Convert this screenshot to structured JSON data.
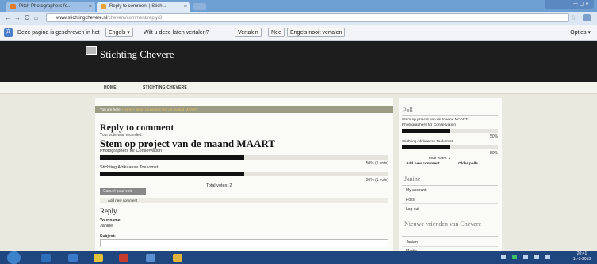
{
  "browser": {
    "tabs": [
      {
        "label": "Pitch Photographers fo..."
      },
      {
        "label": "Reply to comment | Stich..."
      }
    ],
    "address": {
      "host": "www.stichtingchevere.nl",
      "path": "/chevere/comment/reply/3"
    }
  },
  "translate_bar": {
    "message": "Deze pagina is geschreven in het",
    "language_button": "Engels ▾",
    "question": "Wilt u deze laten vertalen?",
    "translate": "Vertalen",
    "no": "Nee",
    "never": "Engels nooit vertalen",
    "options": "Opties ▾"
  },
  "site": {
    "name": "Stichting Chevere",
    "menu": [
      "HOME",
      "STICHTING CHEVERE"
    ]
  },
  "main": {
    "breadcrumb_label": "You are here:",
    "breadcrumb_links": "Home » Stem op project van de maand MAART",
    "page_title": "Reply to comment",
    "vote_recorded": "Your vote was recorded.",
    "poll_title": "Stem op project van de maand MAART",
    "poll_options": [
      {
        "label": "Photographers for Conservation",
        "percent_text": "50% (1 vote)",
        "fraction": 0.5
      },
      {
        "label": "Stichting Afrikaanse Toekomst",
        "percent_text": "50% (1 vote)",
        "fraction": 0.5
      }
    ],
    "total_votes": "Total votes: 2",
    "cancel_vote": "Cancel your vote",
    "add_new_comment": "Add new comment",
    "reply_heading": "Reply",
    "your_name_label": "Your name:",
    "your_name_value": "Janine",
    "subject_label": "Subject:"
  },
  "sidebar": {
    "poll_heading": "Poll",
    "poll_title": "Stem op project van de maand MAART",
    "options": [
      {
        "label": "Photographers for Conservation",
        "percent": "50%",
        "fraction": 0.5
      },
      {
        "label": "Stichting Afrikaanse Toekomst",
        "percent": "50%",
        "fraction": 0.5
      }
    ],
    "total_votes": "Total votes: 2",
    "add_new_comment": "Add new comment",
    "older_polls": "Older polls",
    "user_heading": "Janine",
    "user_menu": [
      "My account",
      "Polls",
      "Log out"
    ],
    "friends_heading": "Nieuwe vrienden van Chevere",
    "friends": [
      "Janien",
      "Martin"
    ]
  },
  "taskbar": {
    "time": "20:41",
    "date": "11-3-2013"
  },
  "colors": {
    "header_bg": "#1d1d1d",
    "page_bg": "#e9e9df",
    "breadcrumb_bg": "#9c9c84",
    "taskbar_bg": "#20467f"
  }
}
